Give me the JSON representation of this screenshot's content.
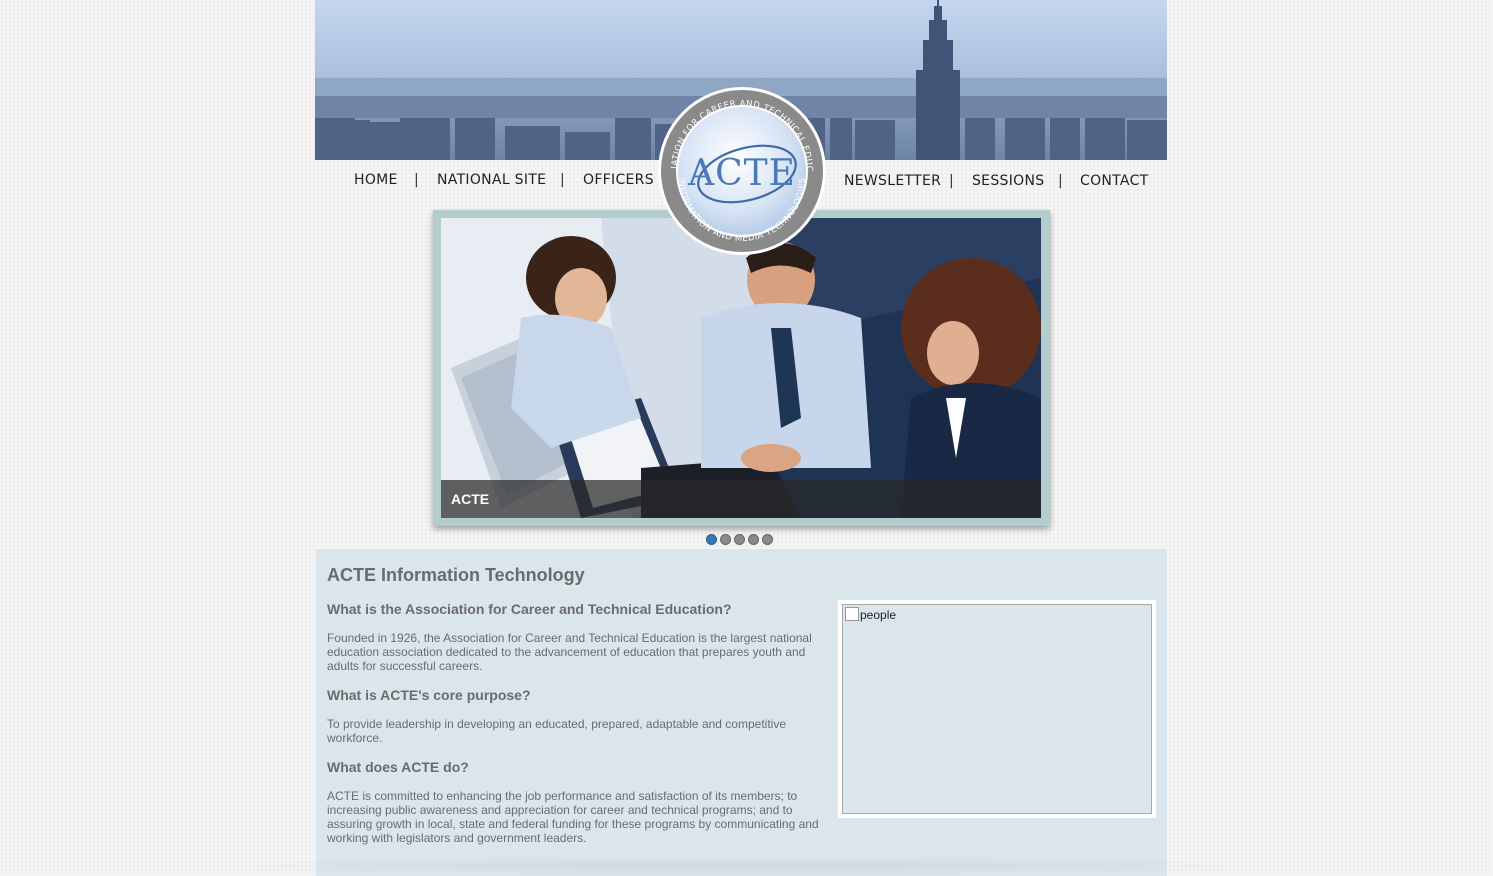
{
  "nav": {
    "items": [
      "HOME",
      "NATIONAL SITE",
      "OFFICERS",
      "NEWSLETTER",
      "SESSIONS",
      "CONTACT"
    ],
    "separator": "|"
  },
  "logo": {
    "text": "ACTE",
    "ring_top": "ASSOCIATION FOR CAREER AND TECHNICAL EDUCATION",
    "ring_bottom": "INFORMATION AND MEDIA TECHNOLOGIES"
  },
  "slider": {
    "caption": "ACTE",
    "slide_count": 5,
    "active_index": 0
  },
  "content": {
    "title": "ACTE Information Technology",
    "q1": "What is the Association for Career and Technical Education?",
    "a1": "Founded in 1926, the Association for Career and Technical Education is the largest national education association dedicated to the advancement of education that prepares youth and adults for successful careers.",
    "q2": "What is ACTE's core purpose?",
    "a2": "To provide leadership in developing an educated, prepared, adaptable and competitive workforce.",
    "q3": "What does ACTE do?",
    "a3": "ACTE is committed to enhancing the job performance and satisfaction of its members; to increasing public awareness and appreciation for career and technical programs; and to assuring growth in local, state and federal funding for these programs by communicating and working with legislators and government leaders.",
    "image_alt": "people"
  },
  "colors": {
    "content_bg": "#dbe6ec",
    "slider_frame": "#b3cccc",
    "active_dot": "#3a78b5"
  }
}
